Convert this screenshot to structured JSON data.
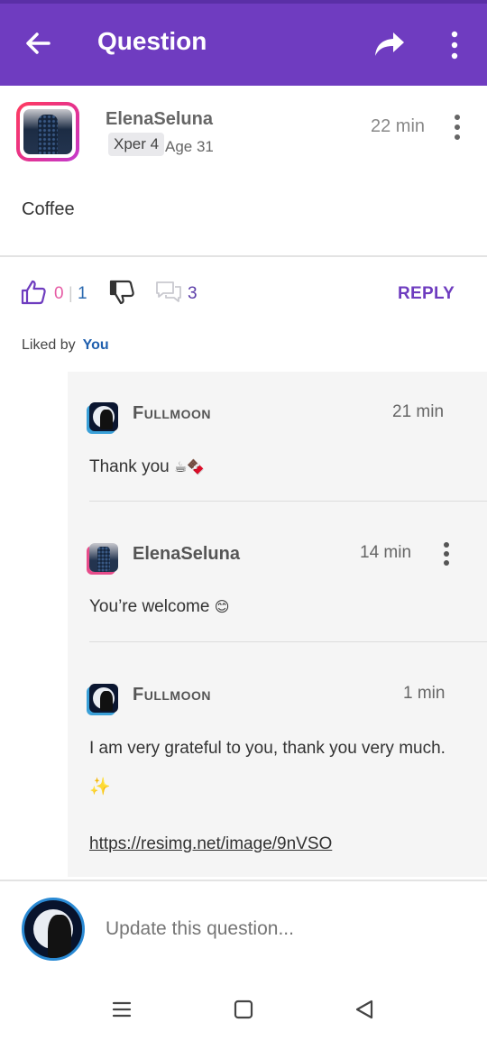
{
  "header": {
    "title": "Question"
  },
  "question": {
    "author": "ElenaSeluna",
    "xper": "Xper 4",
    "age": "Age 31",
    "time": "22 min",
    "body": "Coffee"
  },
  "actions": {
    "likes": "0",
    "separator": "|",
    "dislikes": "1",
    "comments": "3",
    "reply_label": "REPLY"
  },
  "liked_by": {
    "label": "Liked by",
    "user": "You"
  },
  "replies": [
    {
      "author": "Fullmoon",
      "time": "21 min",
      "text": "Thank you",
      "emoji": "☕🍫"
    },
    {
      "author": "ElenaSeluna",
      "time": "14 min",
      "text": "You’re welcome",
      "emoji": "😊"
    },
    {
      "author": "Fullmoon",
      "time": "1 min",
      "text": "I am very grateful to you, thank you very much.",
      "emoji": "✨",
      "link": "https://resimg.net/image/9nVSO"
    }
  ],
  "composer": {
    "placeholder": "Update this question..."
  },
  "icons": {
    "back": "arrow-left-icon",
    "share": "share-icon",
    "more": "more-vertical-icon",
    "like": "thumbs-up-icon",
    "dislike": "thumbs-down-icon",
    "comments": "comments-icon"
  },
  "colors": {
    "accent": "#6f3cc0",
    "like": "#e65ca5",
    "dislike": "#2c6ab0"
  }
}
